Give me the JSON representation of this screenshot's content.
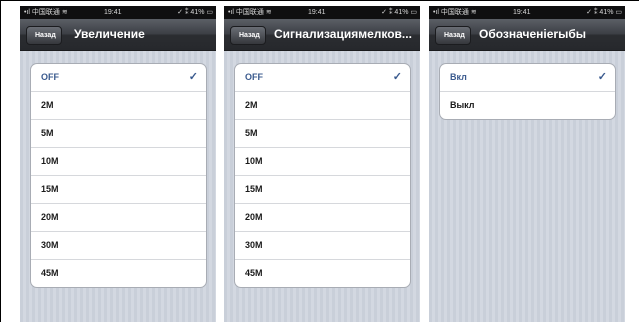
{
  "screens": [
    {
      "status": {
        "carrier": "•ıl 中国联通 ≋",
        "time": "19:41",
        "battery": "✓ ⁑ 41% ▭"
      },
      "nav": {
        "back": "Назад",
        "title": "Увеличение"
      },
      "items": [
        {
          "label": "OFF",
          "selected": true
        },
        {
          "label": "2M"
        },
        {
          "label": "5M"
        },
        {
          "label": "10M"
        },
        {
          "label": "15M"
        },
        {
          "label": "20M"
        },
        {
          "label": "30M"
        },
        {
          "label": "45M"
        }
      ],
      "checkmark": "✓"
    },
    {
      "status": {
        "carrier": "•ıl 中国联通 ≋",
        "time": "19:41",
        "battery": "✓ ⁑ 41% ▭"
      },
      "nav": {
        "back": "Назад",
        "title": "Сигнализациямелков..."
      },
      "items": [
        {
          "label": "OFF",
          "selected": true
        },
        {
          "label": "2M"
        },
        {
          "label": "5M"
        },
        {
          "label": "10M"
        },
        {
          "label": "15M"
        },
        {
          "label": "20M"
        },
        {
          "label": "30M"
        },
        {
          "label": "45M"
        }
      ],
      "checkmark": "✓"
    },
    {
      "status": {
        "carrier": "•ıl 中国联通 ≋",
        "time": "19:41",
        "battery": "✓ ⁑ 41% ▭"
      },
      "nav": {
        "back": "Назад",
        "title": "Обозначенierыбы"
      },
      "items": [
        {
          "label": "Вкл",
          "selected": true
        },
        {
          "label": "Выкл"
        }
      ],
      "checkmark": "✓"
    }
  ],
  "colors": {
    "accent": "#3a5a8e",
    "navbar": "#2b2d31",
    "background": "#cfd4dd"
  }
}
